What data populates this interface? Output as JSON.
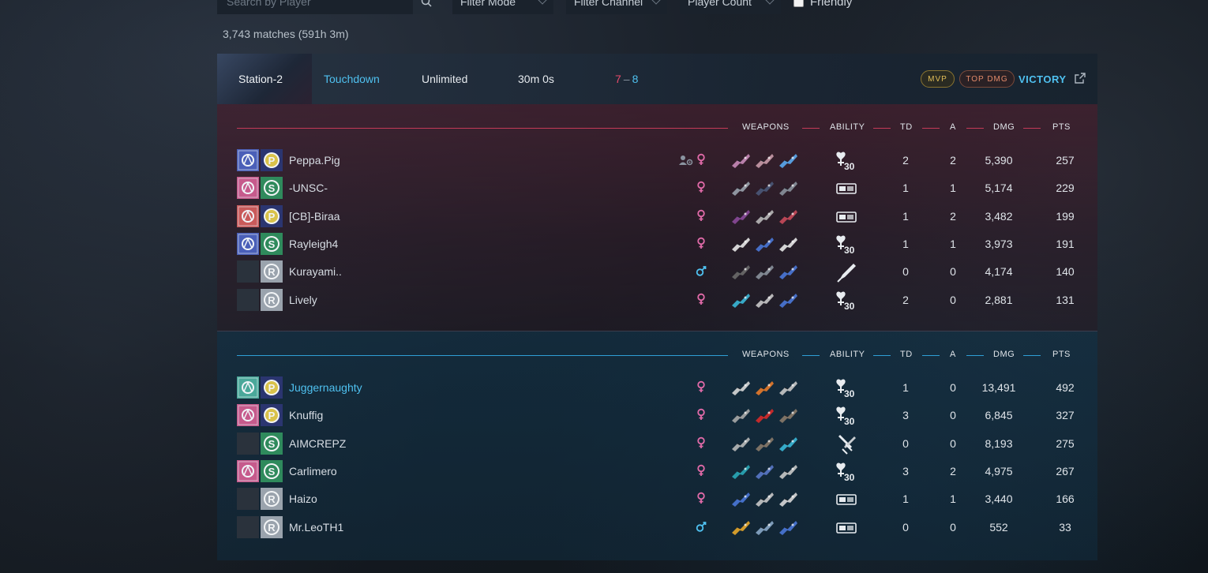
{
  "filters": {
    "search_placeholder": "Search by Player",
    "mode_label": "Filter Mode",
    "channel_label": "Filter Channel",
    "count_label": "Player Count",
    "friendly_label": "Friendly"
  },
  "summary": {
    "matches": "3,743 matches (591h 3m)"
  },
  "match": {
    "map": "Station-2",
    "mode": "Touchdown",
    "limit": "Unlimited",
    "duration": "30m 0s",
    "score_red": "7",
    "score_sep": "–",
    "score_blue": "8",
    "badge_mvp": "MVP",
    "badge_topdmg": "TOP DMG",
    "result": "VICTORY"
  },
  "headers": {
    "weapons": "WEAPONS",
    "ability": "ABILITY",
    "td": "TD",
    "a": "A",
    "dmg": "DMG",
    "pts": "PTS"
  },
  "colors": {
    "red_team": "#c43a58",
    "blue_team": "#2f9fd6",
    "accent": "#4fc1f0",
    "female": "#e06aa8",
    "male": "#4fc1f0"
  },
  "red_team": [
    {
      "name": "Peppa.Pig",
      "gender": "female",
      "party": true,
      "td": "2",
      "a": "2",
      "dmg": "5,390",
      "pts": "257"
    },
    {
      "name": "-UNSC-",
      "gender": "female",
      "party": false,
      "td": "1",
      "a": "1",
      "dmg": "5,174",
      "pts": "229"
    },
    {
      "name": "[CB]-Biraa",
      "gender": "female",
      "party": false,
      "td": "1",
      "a": "2",
      "dmg": "3,482",
      "pts": "199"
    },
    {
      "name": "Rayleigh4",
      "gender": "female",
      "party": false,
      "td": "1",
      "a": "1",
      "dmg": "3,973",
      "pts": "191"
    },
    {
      "name": "Kurayami..",
      "gender": "male",
      "party": false,
      "td": "0",
      "a": "0",
      "dmg": "4,174",
      "pts": "140"
    },
    {
      "name": "Lively",
      "gender": "female",
      "party": false,
      "td": "2",
      "a": "0",
      "dmg": "2,881",
      "pts": "131"
    }
  ],
  "blue_team": [
    {
      "name": "Juggernaughty",
      "gender": "female",
      "party": false,
      "td": "1",
      "a": "0",
      "dmg": "13,491",
      "pts": "492"
    },
    {
      "name": "Knuffig",
      "gender": "female",
      "party": false,
      "td": "3",
      "a": "0",
      "dmg": "6,845",
      "pts": "327"
    },
    {
      "name": "AIMCREPZ",
      "gender": "female",
      "party": false,
      "td": "0",
      "a": "0",
      "dmg": "8,193",
      "pts": "275"
    },
    {
      "name": "Carlimero",
      "gender": "female",
      "party": false,
      "td": "3",
      "a": "2",
      "dmg": "4,975",
      "pts": "267"
    },
    {
      "name": "Haizo",
      "gender": "female",
      "party": false,
      "td": "1",
      "a": "1",
      "dmg": "3,440",
      "pts": "166"
    },
    {
      "name": "Mr.LeoTH1",
      "gender": "male",
      "party": false,
      "td": "0",
      "a": "0",
      "dmg": "552",
      "pts": "33"
    }
  ]
}
